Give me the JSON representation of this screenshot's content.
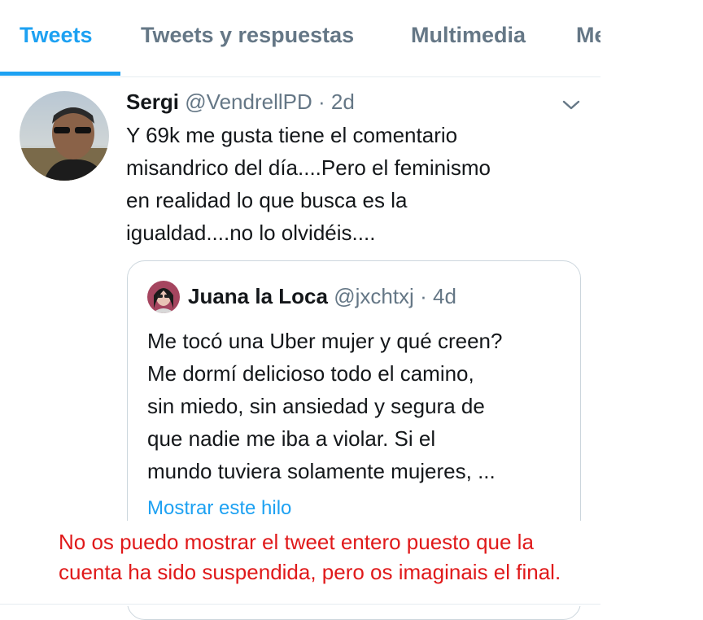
{
  "tabs": [
    {
      "label": "Tweets",
      "active": true
    },
    {
      "label": "Tweets y respuestas",
      "active": false
    },
    {
      "label": "Multimedia",
      "active": false
    },
    {
      "label": "Me",
      "active": false
    }
  ],
  "tweet": {
    "author_name": "Sergi",
    "author_handle": "@VendrellPD",
    "separator": "·",
    "time": "2d",
    "text_lines": [
      "Y 69k me gusta tiene el comentario",
      "misandrico del día....Pero el feminismo",
      "en realidad lo que busca es la",
      "igualdad....no lo olvidéis...."
    ],
    "menu_icon": "chevron-down-icon",
    "quoted": {
      "author_name": "Juana la Loca",
      "author_handle": "@jxchtxj",
      "separator": "·",
      "time": "4d",
      "text_lines": [
        "Me tocó una Uber mujer y qué creen?",
        "Me dormí delicioso todo el camino,",
        "sin miedo, sin ansiedad y segura de",
        "que nadie me iba a violar. Si el",
        "mundo tuviera solamente mujeres, ..."
      ],
      "show_thread": "Mostrar este hilo"
    }
  },
  "annotation": {
    "lines": [
      "No os puedo mostrar el tweet entero puesto que la",
      "cuenta ha sido suspendida, pero os imaginais el final."
    ],
    "color": "#e0191a"
  },
  "colors": {
    "accent": "#1da1f2",
    "secondary_text": "#657786",
    "border": "#ccd6dd"
  }
}
